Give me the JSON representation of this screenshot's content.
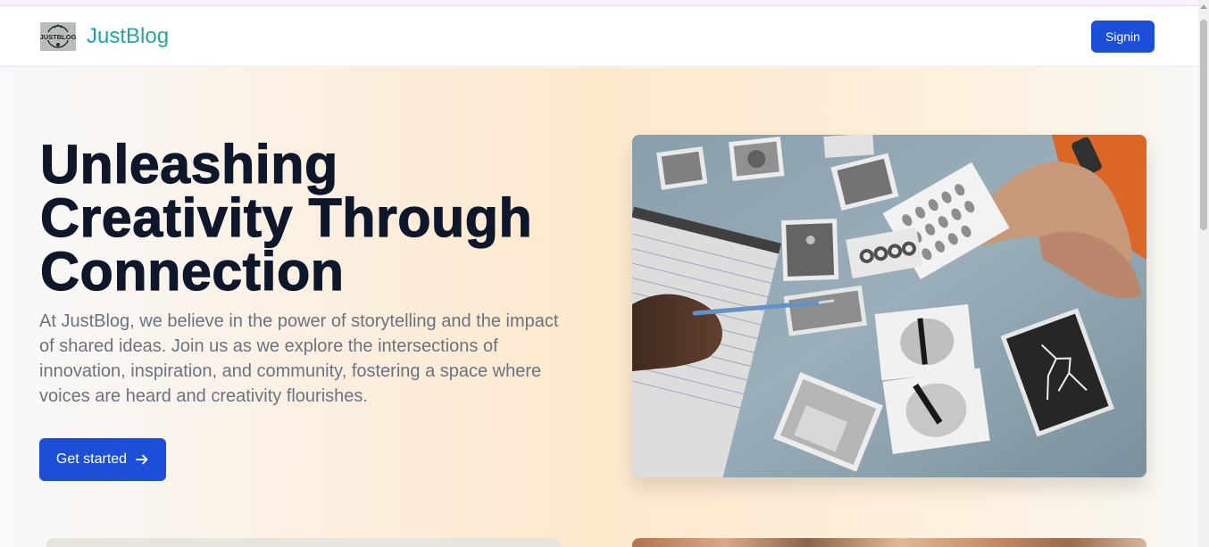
{
  "navbar": {
    "logo_text": "JUSTBLOG",
    "brand": "JustBlog",
    "signin_label": "Signin"
  },
  "hero": {
    "title_lines": [
      "Unleashing",
      "Creativity Through",
      "Connection"
    ],
    "description": "At JustBlog, we believe in the power of storytelling and the impact of shared ideas. Join us as we explore the intersections of innovation, inspiration, and community, fostering a space where voices are heard and creativity flourishes.",
    "cta_label": "Get started",
    "cta_icon": "arrow-right-icon",
    "image_icon": "evidence-photos-image"
  },
  "colors": {
    "primary": "#1d4ed8",
    "heading": "#0f172a",
    "body_text": "#6b7280",
    "brand_gradient_start": "#1aa0b8",
    "brand_gradient_end": "#2aa68f"
  }
}
